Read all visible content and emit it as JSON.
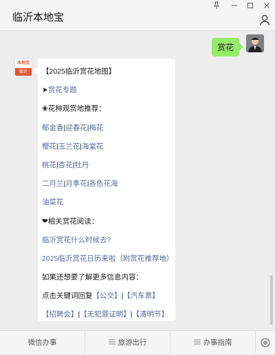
{
  "window": {
    "title": "临沂本地宝",
    "controls": [
      "pin-icon",
      "minimize-icon",
      "maximize-icon",
      "close-icon"
    ]
  },
  "chat": {
    "outgoing": {
      "text": "赏花"
    },
    "bot_avatar": {
      "top": "本地宝",
      "bottom": "临沂"
    },
    "incoming": {
      "header": "【2025临沂赏花地图】",
      "topic_arrow": "➤",
      "topic_link": "赏花专题",
      "spots_title": "❀花种观赏地推荐：",
      "flower_rows": [
        [
          "郁金香",
          "迎春花",
          "梅花"
        ],
        [
          "樱花",
          "玉兰花",
          "海棠花"
        ],
        [
          "桃花",
          "杏花",
          "牡丹"
        ],
        [
          "二月兰",
          "月季花",
          "各色花海"
        ],
        [
          "油菜花"
        ]
      ],
      "separator": "|",
      "related_title": "❤相关赏花阅读：",
      "related_links": [
        "临沂赏花什么时候去?",
        "2025临沂赏花日历来啦（附赏花推荐地）"
      ],
      "more_info": "如果还想要了解更多信息内容：",
      "keyword_prefix": "点击关键词回复",
      "keywords_line1": [
        "【公交】",
        "【汽车票】"
      ],
      "keywords_line2": [
        "【招聘会】",
        "【无犯罪证明】",
        "【清明节】"
      ]
    }
  },
  "bottom_menu": {
    "tabs": [
      "微信办事",
      "旅游出行",
      "办事指南"
    ]
  },
  "colors": {
    "link": "#576b95",
    "bubble_out": "#95ec69",
    "background": "#ededed"
  }
}
